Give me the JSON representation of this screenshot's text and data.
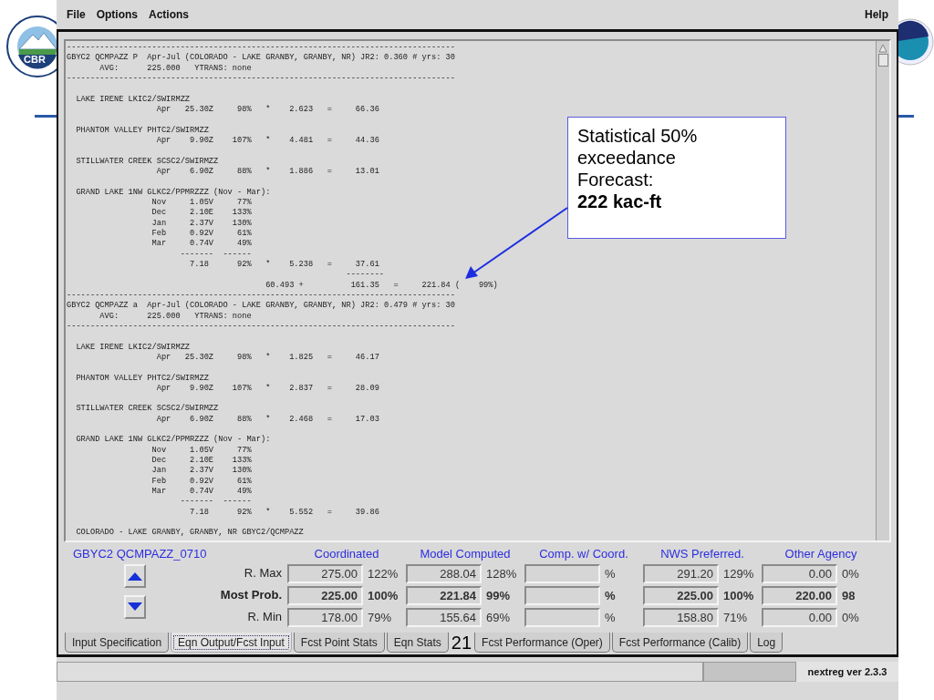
{
  "menu": {
    "items": [
      "File",
      "Options",
      "Actions"
    ],
    "help": "Help"
  },
  "logo": {
    "text": "CBR"
  },
  "output": {
    "blocks": [
      {
        "kind": "header",
        "lines": [
          "----------------------------------------------------------------------------------",
          "GBYC2 QCMPAZZ P  Apr-Jul (COLORADO - LAKE GRANBY, GRANBY, NR) JR2: 0.360 # yrs: 30",
          "       AVG:      225.000   YTRANS: none",
          "----------------------------------------------------------------------------------"
        ]
      },
      {
        "kind": "station",
        "lines": [
          "  LAKE IRENE LKIC2/SWIRMZZ",
          "                   Apr   25.30Z     98%   *    2.623   =     66.36"
        ]
      },
      {
        "kind": "station",
        "lines": [
          "  PHANTOM VALLEY PHTC2/SWIRMZZ",
          "                   Apr    9.90Z    107%   *    4.481   =     44.36"
        ]
      },
      {
        "kind": "station",
        "lines": [
          "  STILLWATER CREEK SCSC2/SWIRMZZ",
          "                   Apr    6.90Z     88%   *    1.886   =     13.01"
        ]
      },
      {
        "kind": "station",
        "lines": [
          "  GRAND LAKE 1NW GLKC2/PPMRZZZ (Nov - Mar):",
          "                  Nov     1.05V     77%",
          "                  Dec     2.10E    133%",
          "                  Jan     2.37V    130%",
          "                  Feb     0.92V     61%",
          "                  Mar     0.74V     49%",
          "                        -------  ------",
          "                          7.18      92%   *    5.238   =     37.61",
          "                                                           --------",
          "                                          60.493 +          161.35   =     221.84 (    99%)"
        ]
      },
      {
        "kind": "header",
        "lines": [
          "----------------------------------------------------------------------------------",
          "GBYC2 QCMPAZZ a  Apr-Jul (COLORADO - LAKE GRANBY, GRANBY, NR) JR2: 0.479 # yrs: 30",
          "       AVG:      225.000   YTRANS: none",
          "----------------------------------------------------------------------------------"
        ]
      },
      {
        "kind": "station",
        "lines": [
          "  LAKE IRENE LKIC2/SWIRMZZ",
          "                   Apr   25.30Z     98%   *    1.825   =     46.17"
        ]
      },
      {
        "kind": "station",
        "lines": [
          "  PHANTOM VALLEY PHTC2/SWIRMZZ",
          "                   Apr    9.90Z    107%   *    2.837   =     28.09"
        ]
      },
      {
        "kind": "station",
        "lines": [
          "  STILLWATER CREEK SCSC2/SWIRMZZ",
          "                   Apr    6.90Z     88%   *    2.468   =     17.03"
        ]
      },
      {
        "kind": "station",
        "lines": [
          "  GRAND LAKE 1NW GLKC2/PPMRZZZ (Nov - Mar):",
          "                  Nov     1.05V     77%",
          "                  Dec     2.10E    133%",
          "                  Jan     2.37V    130%",
          "                  Feb     0.92V     61%",
          "                  Mar     0.74V     49%",
          "                        -------  ------",
          "                          7.18      92%   *    5.552   =     39.86"
        ]
      },
      {
        "kind": "station",
        "lines": [
          "  COLORADO - LAKE GRANBY, GRANBY, NR GBYC2/QCMPAZZ"
        ]
      }
    ]
  },
  "forecast": {
    "id": "GBYC2 QCMPAZZ_0710",
    "rows": [
      {
        "label": "R. Max",
        "emphasis": false
      },
      {
        "label": "Most Prob.",
        "emphasis": true
      },
      {
        "label": "R. Min",
        "emphasis": false
      }
    ],
    "columns": [
      {
        "heading": "Coordinated",
        "cells": [
          {
            "value": "275.00",
            "percent": "122%"
          },
          {
            "value": "225.00",
            "percent": "100%"
          },
          {
            "value": "178.00",
            "percent": "79%"
          }
        ]
      },
      {
        "heading": "Model Computed",
        "cells": [
          {
            "value": "288.04",
            "percent": "128%"
          },
          {
            "value": "221.84",
            "percent": "99%"
          },
          {
            "value": "155.64",
            "percent": "69%"
          }
        ]
      },
      {
        "heading": "Comp. w/ Coord.",
        "cells": [
          {
            "percent": "%"
          },
          {
            "percent": "%"
          },
          {
            "percent": "%"
          }
        ]
      },
      {
        "heading": "NWS Preferred.",
        "cells": [
          {
            "value": "291.20",
            "percent": "129%"
          },
          {
            "value": "225.00",
            "percent": "100%"
          },
          {
            "value": "158.80",
            "percent": "71%"
          }
        ]
      },
      {
        "heading": "Other Agency",
        "cells": [
          {
            "value": "0.00",
            "percent": "0%"
          },
          {
            "value": "220.00",
            "percent": "98"
          },
          {
            "value": "0.00",
            "percent": "0%"
          }
        ]
      }
    ]
  },
  "tabs": [
    {
      "label": "Input Specification",
      "selected": false
    },
    {
      "label": "Eqn Output/Fcst Input",
      "selected": true
    },
    {
      "label": "Fcst Point Stats",
      "selected": false
    },
    {
      "label": "Eqn Stats",
      "selected": false
    },
    {
      "label": "Fcst Performance (Oper)",
      "selected": false
    },
    {
      "label": "Fcst Performance (Calib)",
      "selected": false
    },
    {
      "label": "Log",
      "selected": false
    }
  ],
  "status_bar": {
    "version": "nextreg ver 2.3.3"
  },
  "callout": {
    "lines": [
      "Statistical 50%",
      "exceedance",
      "Forecast:",
      "**222 kac-ft**"
    ]
  },
  "slide_number": "21"
}
